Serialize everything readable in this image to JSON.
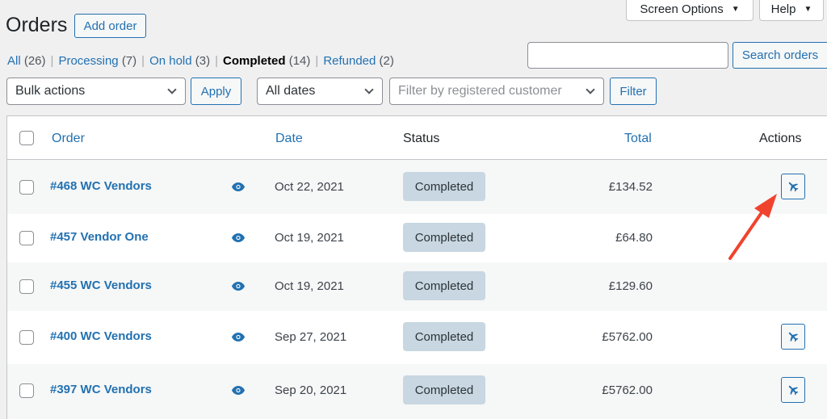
{
  "header": {
    "title": "Orders",
    "add_order_label": "Add order",
    "screen_options_label": "Screen Options",
    "help_label": "Help"
  },
  "status_filters": [
    {
      "label": "All",
      "count": "(26)"
    },
    {
      "label": "Processing",
      "count": "(7)"
    },
    {
      "label": "On hold",
      "count": "(3)"
    },
    {
      "label": "Completed",
      "count": "(14)",
      "current": true
    },
    {
      "label": "Refunded",
      "count": "(2)"
    }
  ],
  "search": {
    "value": "",
    "button_label": "Search orders"
  },
  "toolbar": {
    "bulk_actions": "Bulk actions",
    "apply_label": "Apply",
    "dates": "All dates",
    "customer_placeholder": "Filter by registered customer",
    "filter_label": "Filter"
  },
  "table": {
    "columns": {
      "order": "Order",
      "date": "Date",
      "status": "Status",
      "total": "Total",
      "actions": "Actions"
    },
    "rows": [
      {
        "order": "#468 WC Vendors",
        "date": "Oct 22, 2021",
        "status": "Completed",
        "total": "£134.52",
        "has_action": true
      },
      {
        "order": "#457 Vendor One",
        "date": "Oct 19, 2021",
        "status": "Completed",
        "total": "£64.80",
        "has_action": false
      },
      {
        "order": "#455 WC Vendors",
        "date": "Oct 19, 2021",
        "status": "Completed",
        "total": "£129.60",
        "has_action": false
      },
      {
        "order": "#400 WC Vendors",
        "date": "Sep 27, 2021",
        "status": "Completed",
        "total": "£5762.00",
        "has_action": true
      },
      {
        "order": "#397 WC Vendors",
        "date": "Sep 20, 2021",
        "status": "Completed",
        "total": "£5762.00",
        "has_action": true
      }
    ]
  },
  "colors": {
    "link": "#2271b1",
    "status_badge": "#c8d7e1",
    "annotation_arrow": "#f0432d"
  }
}
